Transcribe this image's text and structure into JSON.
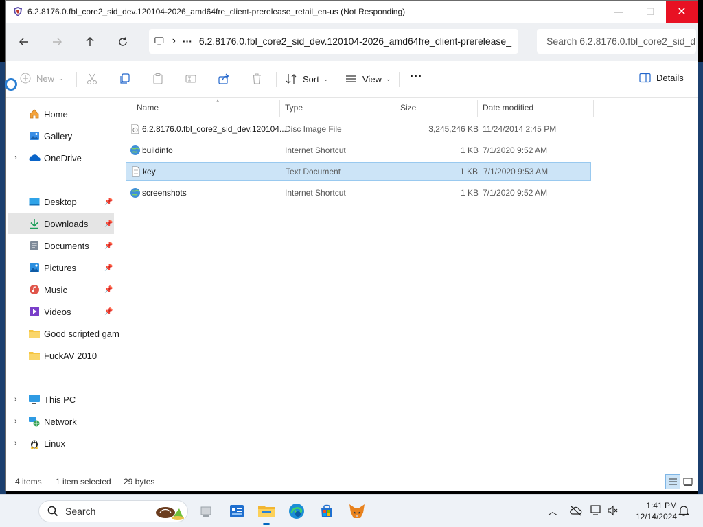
{
  "window": {
    "title": "6.2.8176.0.fbl_core2_sid_dev.120104-2026_amd64fre_client-prerelease_retail_en-us (Not Responding)",
    "minimize_glyph": "—",
    "maximize_glyph": "☐",
    "close_glyph": "✕"
  },
  "nav": {
    "back_icon": "arrow-left-icon",
    "forward_icon": "arrow-right-icon",
    "up_icon": "arrow-up-icon",
    "refresh_icon": "refresh-icon"
  },
  "address": {
    "ellipsis": "···",
    "path": "6.2.8176.0.fbl_core2_sid_dev.120104-2026_amd64fre_client-prerelease_",
    "chevron": "›"
  },
  "search": {
    "placeholder": "Search 6.2.8176.0.fbl_core2_sid_d"
  },
  "toolbar": {
    "new_label": "New",
    "sort_label": "Sort",
    "view_label": "View",
    "more_label": "···",
    "details_label": "Details"
  },
  "sidebar": {
    "items": [
      {
        "label": "Home",
        "icon": "home-icon"
      },
      {
        "label": "Gallery",
        "icon": "gallery-icon"
      },
      {
        "label": "OneDrive",
        "icon": "cloud-icon",
        "expandable": true
      },
      {
        "label": "Desktop",
        "icon": "desktop-icon",
        "pinned": true
      },
      {
        "label": "Downloads",
        "icon": "download-icon",
        "pinned": true,
        "selected": true
      },
      {
        "label": "Documents",
        "icon": "documents-icon",
        "pinned": true
      },
      {
        "label": "Pictures",
        "icon": "pictures-icon",
        "pinned": true
      },
      {
        "label": "Music",
        "icon": "music-icon",
        "pinned": true
      },
      {
        "label": "Videos",
        "icon": "videos-icon",
        "pinned": true
      },
      {
        "label": "Good scripted gam",
        "icon": "folder-icon"
      },
      {
        "label": "FuckAV 2010",
        "icon": "folder-icon"
      },
      {
        "label": "This PC",
        "icon": "pc-icon",
        "expandable": true
      },
      {
        "label": "Network",
        "icon": "network-icon",
        "expandable": true
      },
      {
        "label": "Linux",
        "icon": "linux-icon",
        "expandable": true
      }
    ]
  },
  "columns": {
    "name": "Name",
    "type": "Type",
    "size": "Size",
    "date": "Date modified"
  },
  "files": [
    {
      "name": "6.2.8176.0.fbl_core2_sid_dev.120104...",
      "type": "Disc Image File",
      "size": "3,245,246 KB",
      "date": "11/24/2014 2:45 PM",
      "icon": "disc-image-icon"
    },
    {
      "name": "buildinfo",
      "type": "Internet Shortcut",
      "size": "1 KB",
      "date": "7/1/2020 9:52 AM",
      "icon": "internet-shortcut-icon"
    },
    {
      "name": "key",
      "type": "Text Document",
      "size": "1 KB",
      "date": "7/1/2020 9:53 AM",
      "icon": "text-document-icon",
      "selected": true
    },
    {
      "name": "screenshots",
      "type": "Internet Shortcut",
      "size": "1 KB",
      "date": "7/1/2020 9:52 AM",
      "icon": "internet-shortcut-icon"
    }
  ],
  "status": {
    "count": "4 items",
    "selection": "1 item selected",
    "size": "29 bytes"
  },
  "taskbar": {
    "search_label": "Search",
    "time": "1:41 PM",
    "date": "12/14/2024"
  },
  "colors": {
    "accent": "#0067c0",
    "selection": "#cce4f7",
    "close_red": "#e81123"
  }
}
